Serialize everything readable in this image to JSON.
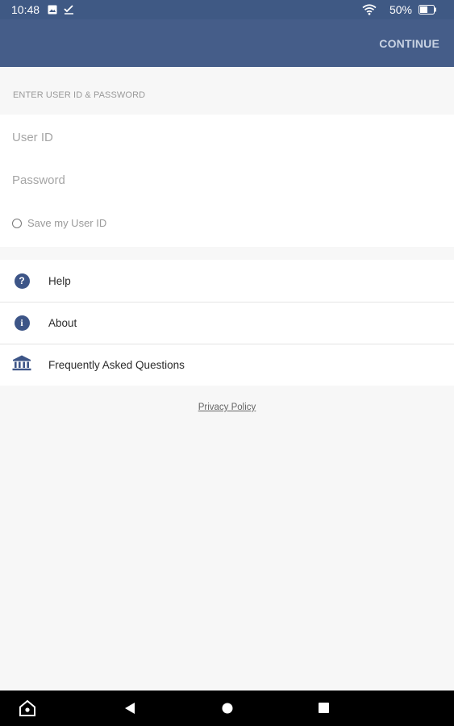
{
  "status_bar": {
    "time": "10:48",
    "battery_percent": "50%",
    "icons": [
      "image-icon",
      "check-icon",
      "wifi-icon",
      "battery-icon"
    ]
  },
  "app_bar": {
    "continue_label": "CONTINUE"
  },
  "login": {
    "section_header": "ENTER USER ID & PASSWORD",
    "user_id_placeholder": "User ID",
    "password_placeholder": "Password",
    "save_user_id_label": "Save my User ID",
    "save_user_id_checked": false
  },
  "menu": {
    "items": [
      {
        "label": "Help",
        "icon": "help-icon"
      },
      {
        "label": "About",
        "icon": "info-icon"
      },
      {
        "label": "Frequently Asked Questions",
        "icon": "bank-icon"
      }
    ]
  },
  "footer": {
    "privacy_policy_label": "Privacy Policy"
  },
  "nav_bar": {
    "icons": [
      "home-assist-icon",
      "back-icon",
      "home-icon",
      "recents-icon"
    ]
  },
  "colors": {
    "app_bar": "#455d89",
    "status_bar": "#3f5984",
    "icon_accent": "#3d5587",
    "background": "#f7f7f7"
  }
}
